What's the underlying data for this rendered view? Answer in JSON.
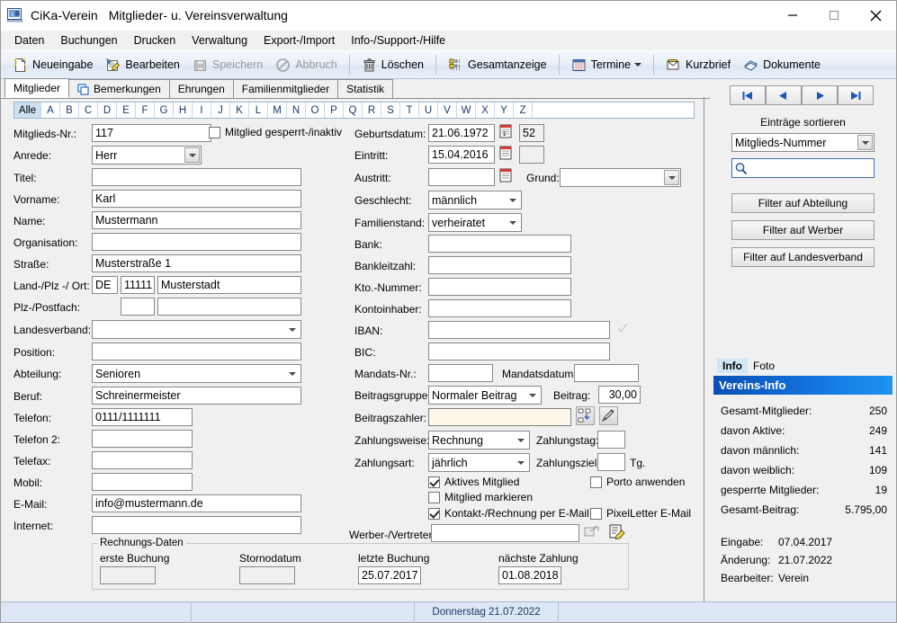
{
  "window": {
    "app_name": "CiKa-Verein",
    "title_suffix": "Mitglieder- u. Vereinsverwaltung",
    "minimize_label": "minimize",
    "maximize_label": "maximize",
    "close_label": "close"
  },
  "menu": [
    {
      "label": "Daten"
    },
    {
      "label": "Buchungen"
    },
    {
      "label": "Drucken"
    },
    {
      "label": "Verwaltung"
    },
    {
      "label": "Export-/Import"
    },
    {
      "label": "Info-/Support-/Hilfe"
    }
  ],
  "toolbar": [
    {
      "label": "Neueingabe",
      "icon": "new-document-icon",
      "disabled": false
    },
    {
      "label": "Bearbeiten",
      "icon": "edit-icon",
      "disabled": false
    },
    {
      "label": "Speichern",
      "icon": "save-disk-icon",
      "disabled": true
    },
    {
      "label": "Abbruch",
      "icon": "cancel-icon",
      "disabled": true
    },
    {
      "label": "Löschen",
      "icon": "trash-icon",
      "disabled": false
    },
    {
      "label": "Gesamtanzeige",
      "icon": "list-view-icon",
      "disabled": false
    },
    {
      "label": "Termine",
      "icon": "calendar-icon",
      "disabled": false,
      "dropdown": true
    },
    {
      "label": "Kurzbrief",
      "icon": "letter-icon",
      "disabled": false
    },
    {
      "label": "Dokumente",
      "icon": "documents-icon",
      "disabled": false
    }
  ],
  "tabs": [
    {
      "label": "Mitglieder",
      "active": true,
      "icon": null
    },
    {
      "label": "Bemerkungen",
      "active": false,
      "icon": "note-icon"
    },
    {
      "label": "Ehrungen",
      "active": false,
      "icon": null
    },
    {
      "label": "Familienmitglieder",
      "active": false,
      "icon": null
    },
    {
      "label": "Statistik",
      "active": false,
      "icon": null
    }
  ],
  "alpha_filter": {
    "all_label": "Alle",
    "selected": "Alle",
    "letters": [
      "A",
      "B",
      "C",
      "D",
      "E",
      "F",
      "G",
      "H",
      "I",
      "J",
      "K",
      "L",
      "M",
      "N",
      "O",
      "P",
      "Q",
      "R",
      "S",
      "T",
      "U",
      "V",
      "W",
      "X",
      "Y",
      "Z"
    ]
  },
  "form": {
    "left": {
      "mitglieds_nr_label": "Mitglieds-Nr.:",
      "mitglieds_nr_value": "117",
      "gesperrt_label": "Mitglied gesperrt-/inaktiv",
      "gesperrt_checked": false,
      "anrede_label": "Anrede:",
      "anrede_value": "Herr",
      "titel_label": "Titel:",
      "titel_value": "",
      "vorname_label": "Vorname:",
      "vorname_value": "Karl",
      "name_label": "Name:",
      "name_value": "Mustermann",
      "organisation_label": "Organisation:",
      "organisation_value": "",
      "strasse_label": "Straße:",
      "strasse_value": "Musterstraße 1",
      "land_plz_ort_label": "Land-/Plz -/ Ort:",
      "land_value": "DE",
      "plz_value": "11111",
      "ort_value": "Musterstadt",
      "plz_postfach_label": "Plz-/Postfach:",
      "plz_postfach_plz_value": "",
      "plz_postfach_value": "",
      "landesverband_label": "Landesverband:",
      "landesverband_value": "",
      "position_label": "Position:",
      "position_value": "",
      "abteilung_label": "Abteilung:",
      "abteilung_value": "Senioren",
      "beruf_label": "Beruf:",
      "beruf_value": "Schreinermeister",
      "telefon_label": "Telefon:",
      "telefon_value": "0111/1111111",
      "telefon2_label": "Telefon 2:",
      "telefon2_value": "",
      "telefax_label": "Telefax:",
      "telefax_value": "",
      "mobil_label": "Mobil:",
      "mobil_value": "",
      "email_label": "E-Mail:",
      "email_value": "info@mustermann.de",
      "internet_label": "Internet:",
      "internet_value": ""
    },
    "right": {
      "geburtsdatum_label": "Geburtsdatum:",
      "geburtsdatum_value": "21.06.1972",
      "alter_value": "52",
      "eintritt_label": "Eintritt:",
      "eintritt_value": "15.04.2016",
      "eintritt_extra_value": "",
      "austritt_label": "Austritt:",
      "austritt_value": "",
      "grund_label": "Grund:",
      "grund_value": "",
      "geschlecht_label": "Geschlecht:",
      "geschlecht_value": "männlich",
      "familienstand_label": "Familienstand:",
      "familienstand_value": "verheiratet",
      "bank_label": "Bank:",
      "bank_value": "",
      "blz_label": "Bankleitzahl:",
      "blz_value": "",
      "kto_label": "Kto.-Nummer:",
      "kto_value": "",
      "kontoinhaber_label": "Kontoinhaber:",
      "kontoinhaber_value": "",
      "iban_label": "IBAN:",
      "iban_value": "",
      "bic_label": "BIC:",
      "bic_value": "",
      "mandats_nr_label": "Mandats-Nr.:",
      "mandats_nr_value": "",
      "mandatsdatum_label": "Mandatsdatum:",
      "mandatsdatum_value": "",
      "beitragsgruppe_label": "Beitragsgruppe:",
      "beitragsgruppe_value": "Normaler Beitrag",
      "beitrag_label": "Beitrag:",
      "beitrag_value": "30,00",
      "beitragszahler_label": "Beitragszahler:",
      "beitragszahler_value": "",
      "zahlungsweise_label": "Zahlungsweise:",
      "zahlungsweise_value": "Rechnung",
      "zahlungstag_label": "Zahlungstag:",
      "zahlungstag_value": "",
      "zahlungsart_label": "Zahlungsart:",
      "zahlungsart_value": "jährlich",
      "zahlungsziel_label": "Zahlungsziel:",
      "zahlungsziel_value": "",
      "zahlungsziel_unit": "Tg.",
      "aktives_mitglied_label": "Aktives Mitglied",
      "aktives_mitglied_checked": true,
      "porto_label": "Porto anwenden",
      "porto_checked": false,
      "markieren_label": "Mitglied markieren",
      "markieren_checked": false,
      "kontakt_email_label": "Kontakt-/Rechnung per E-Mail",
      "kontakt_email_checked": true,
      "pixelletter_label": "PixelLetter E-Mail",
      "pixelletter_checked": false,
      "werber_label": "Werber-/Vertreter:",
      "werber_value": ""
    },
    "rechnungsdaten": {
      "group_title": "Rechnungs-Daten",
      "erste_buchung_label": "erste Buchung",
      "erste_buchung_value": "",
      "stornodatum_label": "Stornodatum",
      "stornodatum_value": "",
      "letzte_buchung_label": "letzte Buchung",
      "letzte_buchung_value": "25.07.2017",
      "naechste_zahlung_label": "nächste Zahlung",
      "naechste_zahlung_value": "01.08.2018"
    }
  },
  "sidebar": {
    "nav": [
      {
        "name": "first-record",
        "glyph": "first"
      },
      {
        "name": "previous-record",
        "glyph": "prev"
      },
      {
        "name": "next-record",
        "glyph": "next"
      },
      {
        "name": "last-record",
        "glyph": "last"
      }
    ],
    "sort_label": "Einträge sortieren",
    "sort_value": "Mitglieds-Nummer",
    "search_value": "",
    "search_placeholder": "",
    "filter_buttons": [
      {
        "label": "Filter auf Abteilung"
      },
      {
        "label": "Filter auf Werber"
      },
      {
        "label": "Filter auf Landesverband"
      }
    ],
    "info_tabs": [
      {
        "label": "Info",
        "active": true
      },
      {
        "label": "Foto",
        "active": false
      }
    ],
    "info_header": "Vereins-Info",
    "info_rows": [
      {
        "key": "Gesamt-Mitglieder:",
        "value": "250"
      },
      {
        "key": "davon Aktive:",
        "value": "249"
      },
      {
        "key": "davon männlich:",
        "value": "141"
      },
      {
        "key": "davon weiblich:",
        "value": "109"
      },
      {
        "key": "gesperrte Mitglieder:",
        "value": "19"
      },
      {
        "key": "Gesamt-Beitrag:",
        "value": "5.795,00"
      }
    ],
    "meta": [
      {
        "key": "Eingabe:",
        "value": "07.04.2017"
      },
      {
        "key": "Änderung:",
        "value": "21.07.2022"
      },
      {
        "key": "Bearbeiter:",
        "value": "Verein"
      }
    ]
  },
  "statusbar": {
    "date_text": "Donnerstag 21.07.2022"
  },
  "colors": {
    "accent_blue": "#1477e0",
    "tab_selected": "#cfe0f2",
    "status_bg": "#dce6f4",
    "cream_field": "#fdf8ea"
  }
}
